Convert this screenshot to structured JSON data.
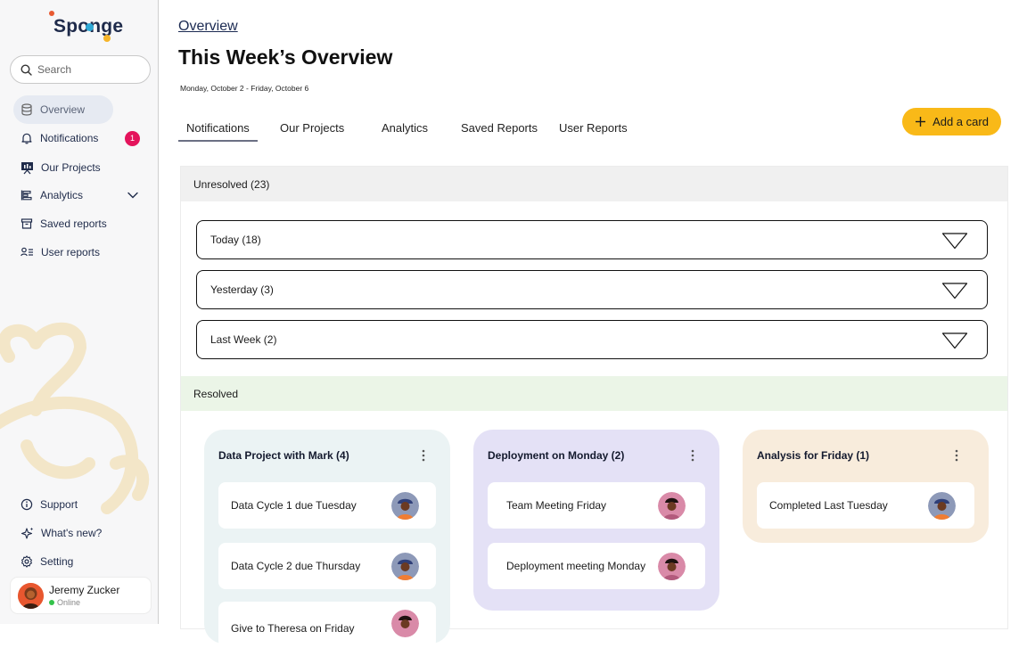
{
  "app": {
    "logo_text": "Sponge"
  },
  "sidebar": {
    "search_placeholder": "Search",
    "items": [
      {
        "label": "Overview",
        "icon": "database-icon"
      },
      {
        "label": "Notifications",
        "icon": "bell-icon",
        "badge": "1"
      },
      {
        "label": "Our Projects",
        "icon": "presentation-icon"
      },
      {
        "label": "Analytics",
        "icon": "bar-chart-icon"
      },
      {
        "label": "Saved reports",
        "icon": "archive-icon"
      },
      {
        "label": "User reports",
        "icon": "user-list-icon"
      }
    ],
    "bottom_items": [
      {
        "label": "Support",
        "icon": "info-icon"
      },
      {
        "label": "What's new?",
        "icon": "sparkle-icon"
      },
      {
        "label": "Setting",
        "icon": "gear-icon"
      }
    ],
    "user": {
      "name": "Jeremy Zucker",
      "status": "Online"
    }
  },
  "header": {
    "breadcrumb": "Overview",
    "title": "This Week’s Overview",
    "date_range": "Monday, October 2 - Friday, October 6"
  },
  "tabs": [
    "Notifications",
    "Our Projects",
    "Analytics",
    "Saved Reports",
    "User Reports"
  ],
  "add_card_label": "Add a card",
  "unresolved": {
    "label": "Unresolved (23)",
    "groups": [
      "Today (18)",
      "Yesterday (3)",
      "Last Week (2)"
    ]
  },
  "resolved": {
    "label": "Resolved",
    "boards": [
      {
        "title": "Data Project with Mark (4)",
        "color": "#ebf3f4",
        "cards": [
          "Data Cycle 1 due Tuesday",
          "Data Cycle 2 due Thursday",
          "Give to Theresa on Friday"
        ]
      },
      {
        "title": "Deployment on Monday (2)",
        "color": "#e4e1f6",
        "cards": [
          "Team Meeting Friday",
          "Deployment meeting Monday"
        ]
      },
      {
        "title": "Analysis for Friday (1)",
        "color": "#f8ecdc",
        "cards": [
          "Completed Last Tuesday"
        ]
      }
    ]
  },
  "colors": {
    "accent": "#f9b918",
    "badge": "#e4145c",
    "active_nav": "#e6eaf2"
  }
}
